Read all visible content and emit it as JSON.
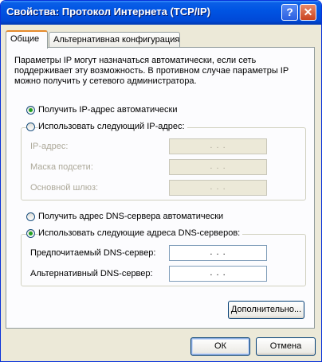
{
  "window": {
    "title": "Свойства: Протокол Интернета (TCP/IP)",
    "help": "?",
    "close": "✕"
  },
  "tabs": [
    {
      "label": "Общие"
    },
    {
      "label": "Альтернативная конфигурация"
    }
  ],
  "intro": "Параметры IP могут назначаться автоматически, если сеть поддерживает эту возможность. В противном случае параметры IP можно получить у сетевого администратора.",
  "ip_section": {
    "auto_label": "Получить IP-адрес автоматически",
    "manual_label": "Использовать следующий IP-адрес:",
    "selected": "auto",
    "fields": [
      {
        "label": "IP-адрес:",
        "value": ". . ."
      },
      {
        "label": "Маска подсети:",
        "value": ". . ."
      },
      {
        "label": "Основной шлюз:",
        "value": ". . ."
      }
    ]
  },
  "dns_section": {
    "auto_label": "Получить адрес DNS-сервера автоматически",
    "manual_label": "Использовать следующие адреса DNS-серверов:",
    "selected": "manual",
    "fields": [
      {
        "label": "Предпочитаемый DNS-сервер:",
        "value": ". . ."
      },
      {
        "label": "Альтернативный DNS-сервер:",
        "value": ". . ."
      }
    ]
  },
  "buttons": {
    "advanced": "Дополнительно...",
    "ok": "ОК",
    "cancel": "Отмена"
  },
  "colors": {
    "titlebar": "#0054e3",
    "dialog_bg": "#ece9d8",
    "tab_accent": "#e68b2c",
    "radio_dot": "#21a121"
  }
}
